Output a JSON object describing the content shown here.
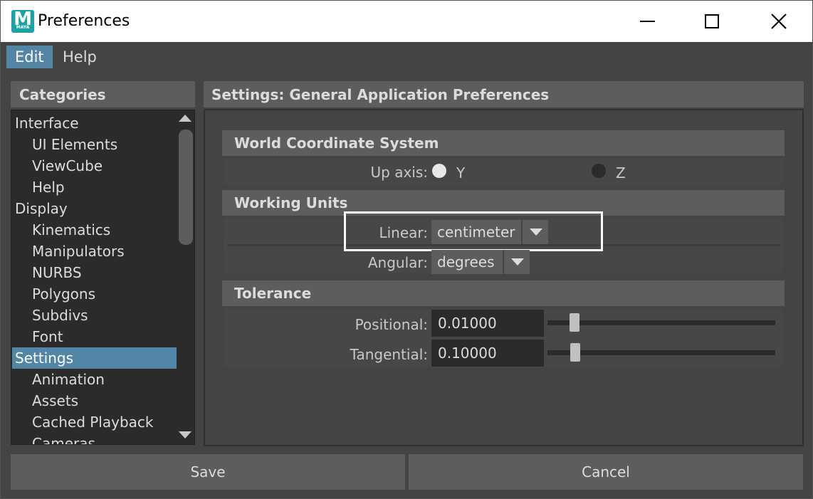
{
  "window": {
    "title": "Preferences",
    "icon_letter": "M",
    "icon_sub": "MAYA"
  },
  "menubar": {
    "items": [
      {
        "label": "Edit",
        "active": true
      },
      {
        "label": "Help",
        "active": false
      }
    ]
  },
  "categories": {
    "header": "Categories",
    "items": [
      {
        "label": "Interface",
        "level": 0
      },
      {
        "label": "UI Elements",
        "level": 1
      },
      {
        "label": "ViewCube",
        "level": 1
      },
      {
        "label": "Help",
        "level": 1
      },
      {
        "label": "Display",
        "level": 0
      },
      {
        "label": "Kinematics",
        "level": 1
      },
      {
        "label": "Manipulators",
        "level": 1
      },
      {
        "label": "NURBS",
        "level": 1
      },
      {
        "label": "Polygons",
        "level": 1
      },
      {
        "label": "Subdivs",
        "level": 1
      },
      {
        "label": "Font",
        "level": 1
      },
      {
        "label": "Settings",
        "level": 0,
        "selected": true
      },
      {
        "label": "Animation",
        "level": 1
      },
      {
        "label": "Assets",
        "level": 1
      },
      {
        "label": "Cached Playback",
        "level": 1
      },
      {
        "label": "Cameras",
        "level": 1
      }
    ]
  },
  "settings": {
    "header": "Settings: General Application Preferences",
    "world_coordinate": {
      "header": "World Coordinate System",
      "up_axis_label": "Up axis:",
      "options": [
        {
          "label": "Y",
          "selected": true
        },
        {
          "label": "Z",
          "selected": false
        }
      ]
    },
    "working_units": {
      "header": "Working Units",
      "linear_label": "Linear:",
      "linear_value": "centimeter",
      "angular_label": "Angular:",
      "angular_value": "degrees"
    },
    "tolerance": {
      "header": "Tolerance",
      "positional_label": "Positional:",
      "positional_value": "0.01000",
      "positional_slider": 0.1,
      "tangential_label": "Tangential:",
      "tangential_value": "0.10000",
      "tangential_slider": 0.1
    }
  },
  "buttons": {
    "save": "Save",
    "cancel": "Cancel"
  },
  "colors": {
    "accent": "#5285a6",
    "panel": "#444444",
    "header": "#5d5d5d",
    "field": "#2b2b2b"
  }
}
